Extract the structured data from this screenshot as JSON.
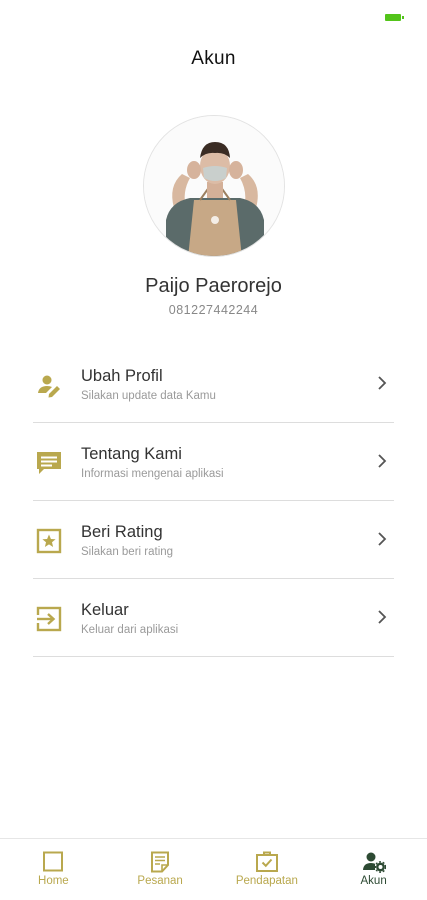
{
  "header": {
    "title": "Akun"
  },
  "colors": {
    "accent": "#b9a84e",
    "active": "#2d4a33",
    "battery": "#53c41a"
  },
  "profile": {
    "name": "Paijo Paerorejo",
    "phone": "081227442244"
  },
  "menu": [
    {
      "title": "Ubah Profil",
      "subtitle": "Silakan update data Kamu",
      "icon": "edit-user-icon"
    },
    {
      "title": "Tentang Kami",
      "subtitle": "Informasi mengenai aplikasi",
      "icon": "message-icon"
    },
    {
      "title": "Beri Rating",
      "subtitle": "Silakan beri rating",
      "icon": "star-box-icon"
    },
    {
      "title": "Keluar",
      "subtitle": "Keluar dari aplikasi",
      "icon": "logout-icon"
    }
  ],
  "nav": [
    {
      "label": "Home",
      "icon": "home-icon",
      "active": false
    },
    {
      "label": "Pesanan",
      "icon": "orders-icon",
      "active": false
    },
    {
      "label": "Pendapatan",
      "icon": "income-icon",
      "active": false
    },
    {
      "label": "Akun",
      "icon": "account-settings-icon",
      "active": true
    }
  ]
}
